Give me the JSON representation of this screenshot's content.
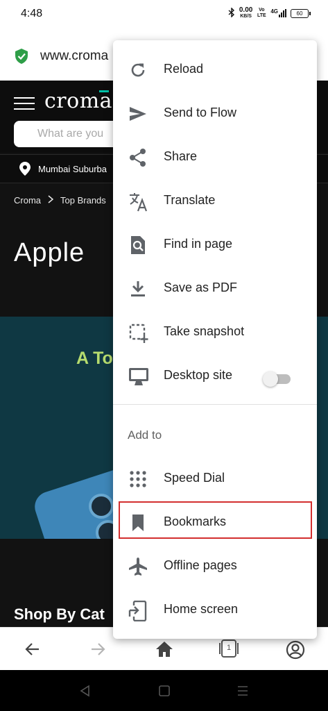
{
  "status_bar": {
    "time": "4:48",
    "net_speed": "0.00",
    "net_unit": "KB/S",
    "volte": "Vo LTE",
    "network": "4G",
    "battery": "60"
  },
  "url_bar": {
    "url": "www.croma"
  },
  "page": {
    "logo": "croma",
    "search_placeholder": "What are you",
    "location": "Mumbai Suburba",
    "breadcrumb": [
      "Croma",
      "Top Brands"
    ],
    "title": "Apple",
    "banner_headline": "A To",
    "section_title": "Shop By Cat"
  },
  "menu": {
    "items": [
      {
        "label": "Reload",
        "icon": "reload-icon"
      },
      {
        "label": "Send to Flow",
        "icon": "send-icon"
      },
      {
        "label": "Share",
        "icon": "share-icon"
      },
      {
        "label": "Translate",
        "icon": "translate-icon"
      },
      {
        "label": "Find in page",
        "icon": "find-in-page-icon"
      },
      {
        "label": "Save as PDF",
        "icon": "download-icon"
      },
      {
        "label": "Take snapshot",
        "icon": "snapshot-icon"
      },
      {
        "label": "Desktop site",
        "icon": "desktop-icon",
        "toggle": false
      }
    ],
    "add_to_label": "Add to",
    "add_to_items": [
      {
        "label": "Speed Dial",
        "icon": "speed-dial-icon"
      },
      {
        "label": "Bookmarks",
        "icon": "bookmark-icon",
        "highlighted": true
      },
      {
        "label": "Offline pages",
        "icon": "airplane-icon"
      },
      {
        "label": "Home screen",
        "icon": "home-screen-icon"
      }
    ]
  },
  "bottom_bar": {
    "tab_count": "1"
  },
  "colors": {
    "highlight_border": "#d32f2f",
    "menu_icon": "#5f6368",
    "secure_shield": "#2e9e48",
    "banner_bg": "#0f3843",
    "banner_headline": "#b6dc6e"
  }
}
